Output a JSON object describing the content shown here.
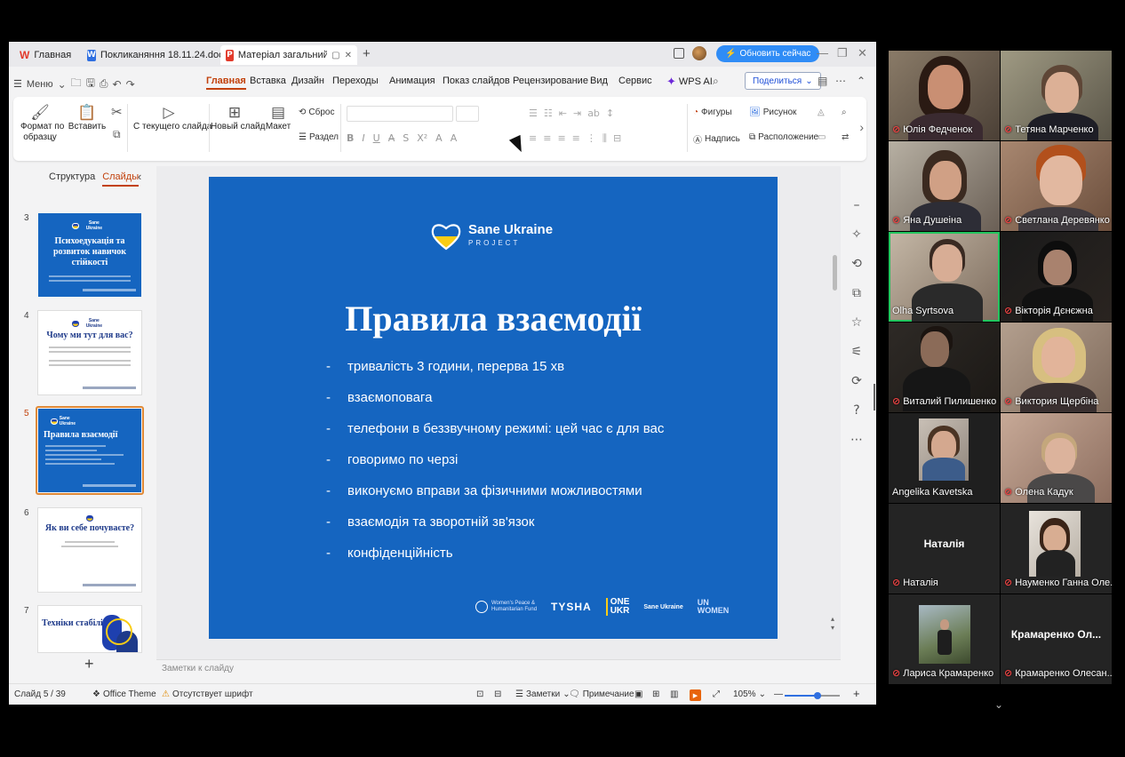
{
  "tabs": [
    {
      "label": "Главная",
      "icon": "wps-logo-icon"
    },
    {
      "label": "Покликаняння 18.11.24.doc",
      "icon": "word-doc-icon"
    },
    {
      "label": "Матеріал загальний (педагог",
      "icon": "presentation-doc-icon"
    }
  ],
  "titlebar": {
    "update_label": "Обновить сейчас"
  },
  "menu": {
    "menu_label": "Меню",
    "ribbon_tabs": [
      "Главная",
      "Вставка",
      "Дизайн",
      "Переходы",
      "Анимация",
      "Показ слайдов",
      "Рецензирование",
      "Вид",
      "Сервис"
    ],
    "wps_ai": "WPS AI",
    "share": "Поделиться"
  },
  "ribbon": {
    "format_painter": "Формат по\nобразцу",
    "paste": "Вставить",
    "from_current": "С текущего слайда",
    "new_slide": "Новый слайд",
    "layout": "Макет",
    "reset": "Сброс",
    "section": "Раздел",
    "shapes": "Фигуры",
    "picture": "Рисунок",
    "textbox": "Надпись",
    "arrange": "Расположение"
  },
  "slides_panel": {
    "tab_outline": "Структура",
    "tab_slides": "Слайды",
    "thumbs": [
      {
        "num": "3",
        "title": "Психоедукація та розвиток навичок стійкості"
      },
      {
        "num": "4",
        "title": "Чому ми тут для вас?"
      },
      {
        "num": "5",
        "title": "Правила взаємодії"
      },
      {
        "num": "6",
        "title": "Як ви себе почуваєте?"
      },
      {
        "num": "7",
        "title": "Техніки стабілізації"
      }
    ]
  },
  "slide": {
    "logo_title": "Sane Ukraine",
    "logo_sub": "PROJECT",
    "title": "Правила взаємодії",
    "bullets": [
      "тривалість 3 години, перерва 15 хв",
      "взаємоповага",
      "телефони в беззвучному режимі: цей час є для вас",
      "говоримо по черзі",
      "виконуємо вправи за фізичними можливостями",
      "взаємодія та зворотній зв'язок",
      "конфіденційність"
    ],
    "partners": {
      "wph": "Women's Peace &\nHumanitarian Fund",
      "tysha": "TYSHA",
      "one_a": "ONE",
      "one_b": "UKR",
      "sane": "Sane Ukraine",
      "un_a": "UN",
      "un_b": "WOMEN"
    },
    "colors": {
      "background": "#1565c0",
      "accent_yellow": "#facc15"
    }
  },
  "notes_placeholder": "Заметки к слайду",
  "status": {
    "slide_counter": "Слайд 5 / 39",
    "theme": "Office Theme",
    "font_warning": "Отсутствует шрифт",
    "notes": "Заметки",
    "comment": "Примечание",
    "zoom": "105%",
    "zoom_fraction": 0.6
  },
  "participants": [
    {
      "name": "Юлія Федченок",
      "muted": true
    },
    {
      "name": "Тетяна Марченко",
      "muted": true
    },
    {
      "name": "Яна Душеіна",
      "muted": true
    },
    {
      "name": "Светлана Деревянко",
      "muted": true
    },
    {
      "name": "Olha Syrtsova",
      "muted": false
    },
    {
      "name": "Вікторія Дєнєжна",
      "muted": true
    },
    {
      "name": "Виталий Пилишенко",
      "muted": true
    },
    {
      "name": "Виктория Щербіна",
      "muted": true
    },
    {
      "name": "Angelika Kavetska",
      "muted": false
    },
    {
      "name": "Олена Кадук",
      "muted": true
    },
    {
      "name": "Наталія",
      "muted": true,
      "big_label": "Наталія"
    },
    {
      "name": "Науменко Ганна Оле...",
      "muted": true
    },
    {
      "name": "Лариса Крамаренко",
      "muted": true
    },
    {
      "name": "Крамаренко Олесан...",
      "muted": true,
      "big_label": "Крамаренко Ол..."
    }
  ]
}
